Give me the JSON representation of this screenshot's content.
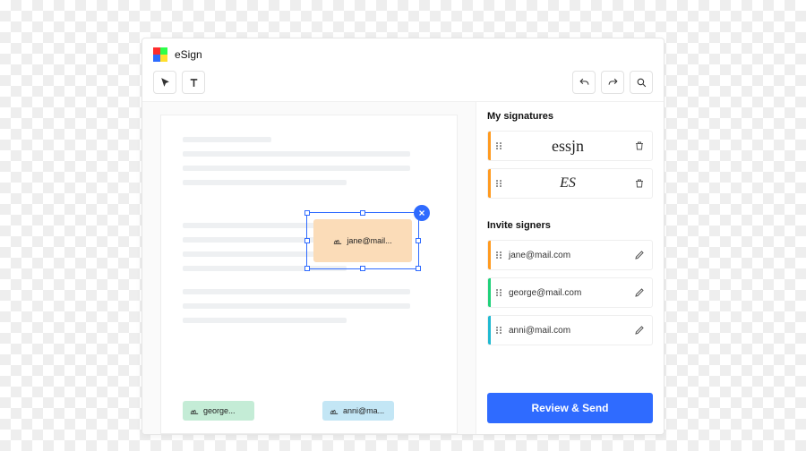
{
  "app": {
    "title": "eSign"
  },
  "fields": {
    "jane": {
      "label": "jane@mail..."
    },
    "george": {
      "label": "george..."
    },
    "anni": {
      "label": "anni@ma..."
    }
  },
  "sidebar": {
    "signatures_title": "My signatures",
    "signatures": [
      {
        "display": "essjn"
      },
      {
        "display": "ES"
      }
    ],
    "invite_title": "Invite signers",
    "signers": [
      {
        "email": "jane@mail.com",
        "color": "orange"
      },
      {
        "email": "george@mail.com",
        "color": "green"
      },
      {
        "email": "anni@mail.com",
        "color": "cyan"
      }
    ]
  },
  "actions": {
    "primary": "Review & Send"
  }
}
